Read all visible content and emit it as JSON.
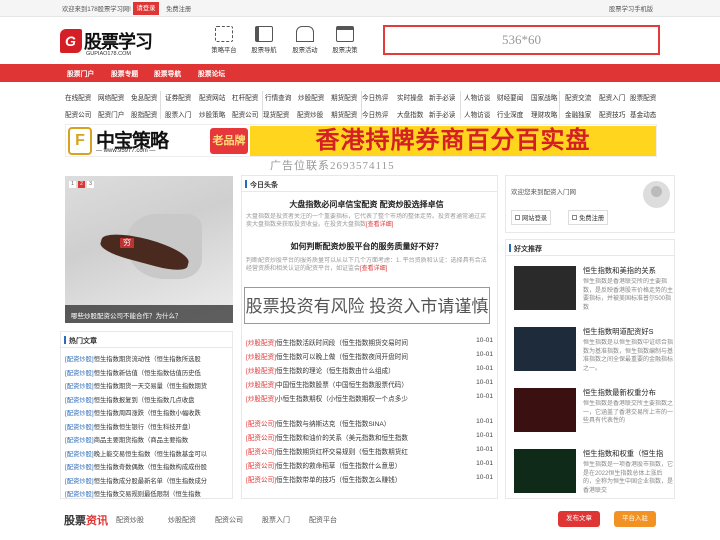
{
  "topbar": {
    "welcome": "欢迎来到178股票学习网!",
    "login": "请登录",
    "register": "免费注册",
    "mobile": "股票学习手机版"
  },
  "header": {
    "logo_main": "股票学习",
    "logo_sub": "GUPIAO178.COM",
    "logo_mark": "G",
    "nav": [
      {
        "label": "策略平台",
        "icon": "grid-icon"
      },
      {
        "label": "股票导航",
        "icon": "list-icon"
      },
      {
        "label": "股票活动",
        "icon": "building-icon"
      },
      {
        "label": "股票决策",
        "icon": "briefcase-icon"
      }
    ],
    "ad": "536*60"
  },
  "rednav": [
    "股票门户",
    "股票专题",
    "股票导航",
    "股票论坛"
  ],
  "links_row1": [
    "在线配资",
    "网络配资",
    "免息配资",
    "证券配资",
    "配资网站",
    "杠杆配资",
    "行情查询",
    "炒股配资",
    "期货配资",
    "今日热评",
    "实时操盘",
    "新手必读",
    "人物访谈",
    "财经要闻",
    "国家战略",
    "配资交流",
    "配资入门",
    "股票配资"
  ],
  "links_row2": [
    "配资公司",
    "配资门户",
    "股指配资",
    "股票入门",
    "炒股策略",
    "配资公司",
    "现货配资",
    "配资炒股",
    "期货配资",
    "今日热评",
    "大盘指数",
    "新手必读",
    "人物访谈",
    "行业深度",
    "理财攻略",
    "金融独家",
    "配资技巧",
    "基金动态",
    "期货开户"
  ],
  "banner": {
    "logo_char": "F",
    "name": "中宝策略",
    "url": "— www.95977.com —",
    "old_brand": "老品牌",
    "slogan": "香港持牌券商百分百实盘",
    "contact": "广告位联系2693574115"
  },
  "slider": {
    "dots": [
      "1",
      "2",
      "3"
    ],
    "caption": "哪些炒股配资公司不能合作？为什么？",
    "tag": "穷"
  },
  "hot": {
    "title": "热门文章",
    "items": [
      {
        "cat": "[配资炒股]",
        "text": "恒生指数期货流动性（恒生指数所选股"
      },
      {
        "cat": "[配资炒股]",
        "text": "恒生指数新估值（恒生指数估值历史低"
      },
      {
        "cat": "[配资炒股]",
        "text": "恒生指数期货一天交易量（恒生指数期货"
      },
      {
        "cat": "[配资炒股]",
        "text": "恒生指数报复到（恒生指数几点收盘"
      },
      {
        "cat": "[配资炒股]",
        "text": "恒生指数周四涨跌（恒生指数小幅收跌"
      },
      {
        "cat": "[配资炒股]",
        "text": "恒生指数恒生银行（恒生科技开盘）"
      },
      {
        "cat": "[配资炒股]",
        "text": "商品主要期货指数（商品主要指数"
      },
      {
        "cat": "[配资炒股]",
        "text": "晚上能交易恒生指数（恒生指数基金可以"
      },
      {
        "cat": "[配资炒股]",
        "text": "恒生指数奇数偶数（恒生指数构成成份股"
      },
      {
        "cat": "[配资炒股]",
        "text": "恒生指数成分股最新名单（恒生指数成分"
      },
      {
        "cat": "[配资炒股]",
        "text": "恒生指数交易规则最低限制（恒生指数"
      }
    ]
  },
  "middle": {
    "title": "今日头条",
    "h1": "大盘指数必问卓信宝配资 配资炒股选择卓信",
    "s1": "大盘指数是投资者关注的一个重要指标，它代表了整个市场的整体走势。投资者通常通过买卖大盘指数来获取投资收益。在投资大盘指数",
    "s1more": "[查看详细]",
    "h2": "如何判断配资炒股平台的服务质量好不好？",
    "s2": "判断配资炒股平台的服务质量可以从以下几个方面考虑：1. 平台资质和认证：选择具有合法经营资质和相关认证的配资平台，如证监会",
    "s2more": "[查看详细]",
    "warning": "股票投资有风险 投资入市请谨慎",
    "list": [
      {
        "cat": "[炒股配资]",
        "text": "恒生指数活跃时间段（恒生指数期货交易时间",
        "date": "10-01"
      },
      {
        "cat": "[炒股配资]",
        "text": "恒生指数可以晚上做（恒生指数夜间开盘时间",
        "date": "10-01"
      },
      {
        "cat": "[炒股配资]",
        "text": "恒生指数的理论（恒生指数由什么组成）",
        "date": "10-01"
      },
      {
        "cat": "[炒股配资]",
        "text": "中国恒生指数股票（中国恒生指数股票代码）",
        "date": "10-01"
      },
      {
        "cat": "[炒股配资]",
        "text": "小恒生指数期权（小恒生指数期权一个点多少",
        "date": "10-01"
      },
      {
        "cat": "[配资公司]",
        "text": "恒生指数与纳斯达克（恒生指数SINA）",
        "date": "10-01"
      },
      {
        "cat": "[配资公司]",
        "text": "恒生指数和油价的关系（美元指数和恒生指数",
        "date": "10-01"
      },
      {
        "cat": "[配资公司]",
        "text": "恒生指数期货红杯交易规则（恒生指数期货红",
        "date": "10-01"
      },
      {
        "cat": "[配资公司]",
        "text": "恒生指数的救命稻草（恒生指数什么意思）",
        "date": "10-01"
      },
      {
        "cat": "[配资公司]",
        "text": "恒生指数带单的技巧（恒生指数怎么赚钱）",
        "date": "10-01"
      }
    ]
  },
  "right": {
    "welcome": "欢迎您来到配资入门网",
    "login": "网站登录",
    "register": "免费注册",
    "rec_title": "好文推荐",
    "items": [
      {
        "title": "恒生指数和美指的关系",
        "desc": "恒生指数是香港联交所的主要指数，是反映香港股市价格走势的主要指标，并被美国标准普尔500指数"
      },
      {
        "title": "恒生指数明道配资好S",
        "desc": "恒生指数是以恒生指数中证综合指数为基准指数，恒生指数编制与基准指数之间全保最重要的金融指标之一。"
      },
      {
        "title": "恒生指数最新权重分布",
        "desc": "恒生指数是香港联交所主要指数之一，它涵盖了香港交易所上市的一些具有代表性的"
      },
      {
        "title": "恒生指数和权重（恒生指",
        "desc": "恒生指数是一项香港股市指数，它是在2022恒生指数总体上涨后的，全称为恒生中国企业指数，是香港联交"
      }
    ]
  },
  "bottom": {
    "title1": "股票",
    "title2": "资讯",
    "tabs": [
      "配资炒股",
      "炒股配资",
      "配资公司",
      "股票入门",
      "配资平台"
    ],
    "publish": "发布文章",
    "join": "平台入驻"
  }
}
